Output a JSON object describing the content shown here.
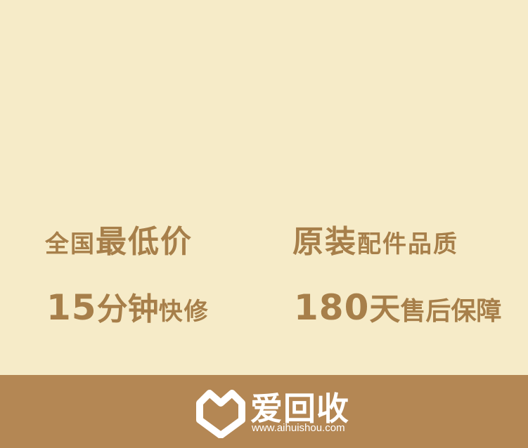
{
  "features": {
    "lowest_price": {
      "small": "全国",
      "large": "最低价"
    },
    "original_parts": {
      "large": "原装",
      "small": "配件品质"
    },
    "fast_repair": {
      "number": "15",
      "large": "分钟",
      "small": "快修"
    },
    "warranty": {
      "number": "180",
      "large": "天",
      "small": "售后保障"
    }
  },
  "footer": {
    "brand_name": "爱回收",
    "url": "www.aihuishou.com",
    "logo_icon": "heart-shield-logo-icon"
  },
  "colors": {
    "background": "#f6ebc8",
    "text": "#a77f4a",
    "footer": "#b48754"
  }
}
